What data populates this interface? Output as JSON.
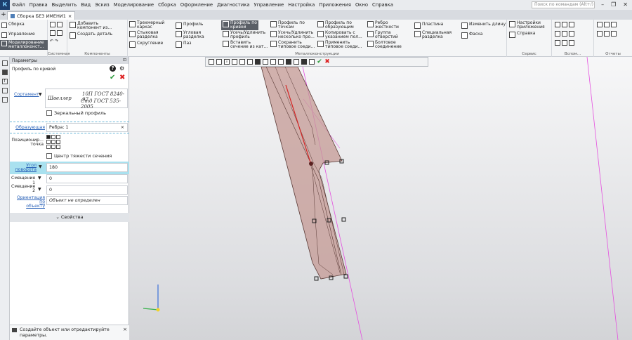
{
  "menu": [
    "Файл",
    "Правка",
    "Выделить",
    "Вид",
    "Эскиз",
    "Моделирование",
    "Сборка",
    "Оформление",
    "Диагностика",
    "Управление",
    "Настройка",
    "Приложения",
    "Окно",
    "Справка"
  ],
  "search_placeholder": "Поиск по командам (Alt+/)",
  "tab": {
    "title": "Сборка БЕЗ ИМЕНИ1",
    "close": "×"
  },
  "ribbon": {
    "left_items": [
      "Сборка",
      "Управление",
      "Моделирование\nметаллоконст..."
    ],
    "system_caption": "Системная",
    "components": {
      "add": "Добавить\nкомпонент из...",
      "create": "Создать деталь",
      "caption": "Компоненты"
    },
    "metal": {
      "caption": "Металлоконструкции",
      "items": [
        "Трехмерный\nкаркас",
        "Стыковая\nразделка",
        "Скругление",
        "Профиль",
        "Угловая\nразделка",
        "Паз",
        "Профиль по\nкривой",
        "Усечь/Удлинить\nпрофиль",
        "Вставить\nсечение из кат...",
        "Профиль по\nточкам",
        "Усечь/Удлинить\nнесколько про...",
        "Сохранить\nтиповое соеди...",
        "Профиль по\nобразующим",
        "Копировать с\nуказанием пол...",
        "Применить\nтиповое соеди...",
        "Ребро\nжесткости",
        "Группа\nотверстий",
        "Болтовое\nсоединение",
        "Пластина",
        "Специальная\nразделка",
        "Изменить длину",
        "Фаска"
      ]
    },
    "service": {
      "caption": "Сервис",
      "items": [
        "Настройки\nприложения",
        "Справка"
      ]
    },
    "aux_caption": "Вспом...",
    "reports_caption": "Отчеты"
  },
  "panel": {
    "header": "Параметры",
    "command": "Профиль по кривой",
    "sortament_label": "Сортамент",
    "sortament_line1": "Швеллер",
    "sortament_line2": "10П ГОСТ 8240-97",
    "sortament_line3": "Ст0 ГОСТ 535-2005",
    "mirror": "Зеркальный профиль",
    "reference_label": "Образующая",
    "reference_value": "Ребра: 1",
    "clear": "×",
    "position_label": "Позиционир...\nточка",
    "center_of_gravity": "Центр тяжести сечения",
    "angle_label": "Угол\nповорота",
    "angle_value": "180",
    "offset1_label": "Смещение 1",
    "offset1_value": "0",
    "offset2_label": "Смещение\n2",
    "offset2_value": "0",
    "orientation_label": "Ориентация по\nобъекту",
    "orientation_value": "Объект не определен",
    "properties": "Свойства"
  },
  "status": "Создайте объект или отредактируйте параметры.",
  "colors": {
    "accent": "#a9e1ef",
    "ok": "#2a9a3a",
    "cancel": "#dd2222",
    "profile_fill": "#c49a94",
    "guide": "#e54fe0"
  }
}
